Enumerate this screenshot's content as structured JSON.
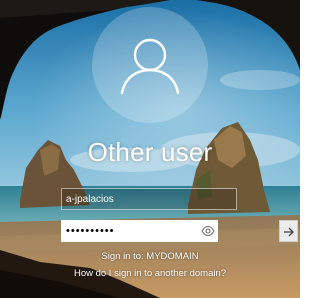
{
  "login": {
    "user_name_heading": "Other user",
    "username_value": "a-jpalacios",
    "password_mask": "••••••••••",
    "sign_in_to": "Sign in to: MYDOMAIN",
    "other_domain_link": "How do I sign in to another domain?"
  },
  "icons": {
    "avatar": "user-silhouette-icon",
    "reveal_password": "eye-icon",
    "submit": "arrow-right-icon"
  },
  "colors": {
    "sky": "#2a7fb0",
    "sea": "#3a93a6",
    "sand": "#b08a5c",
    "text": "#ffffff"
  }
}
